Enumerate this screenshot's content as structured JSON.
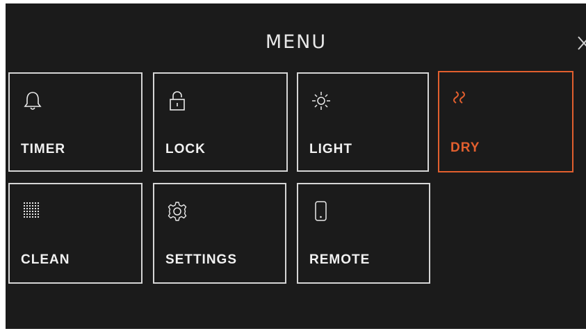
{
  "menu": {
    "title": "MENU",
    "close_icon": "close-icon",
    "accent_color": "#e25f2e",
    "items": [
      {
        "label": "TIMER",
        "icon": "bell-icon",
        "active": false
      },
      {
        "label": "LOCK",
        "icon": "lock-icon",
        "active": false
      },
      {
        "label": "LIGHT",
        "icon": "sun-icon",
        "active": false
      },
      {
        "label": "DRY",
        "icon": "heat-waves-icon",
        "active": true
      },
      {
        "label": "CLEAN",
        "icon": "dot-grid-icon",
        "active": false
      },
      {
        "label": "SETTINGS",
        "icon": "gear-icon",
        "active": false
      },
      {
        "label": "REMOTE",
        "icon": "phone-icon",
        "active": false
      }
    ]
  }
}
